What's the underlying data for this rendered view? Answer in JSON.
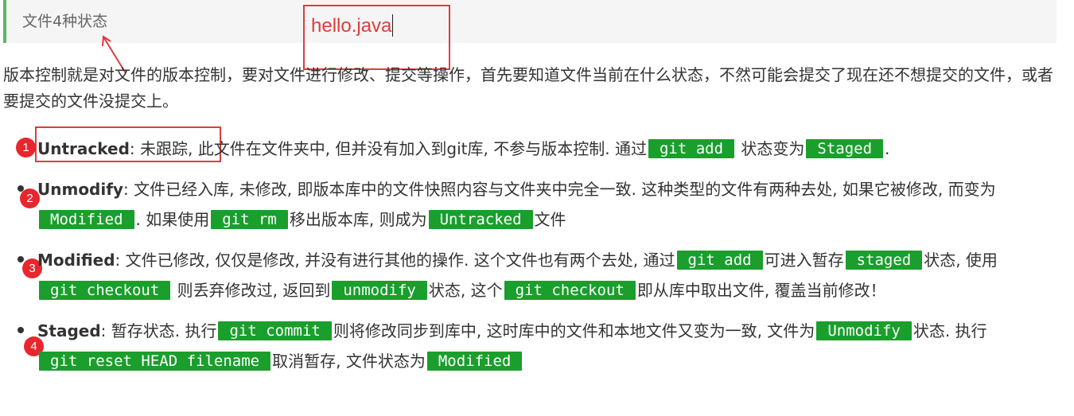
{
  "heading": {
    "title": "文件4种状态"
  },
  "annotation": {
    "text": "hello.java"
  },
  "intro": "版本控制就是对文件的版本控制，要对文件进行修改、提交等操作，首先要知道文件当前在什么状态，不然可能会提交了现在还不想提交的文件，或者要提交的文件没提交上。",
  "items": [
    {
      "marker": "1",
      "term": "Untracked",
      "seg0": ": 未跟踪, 此文件在文件夹中, 但并没有加入到git库, 不参与版本控制. 通过",
      "code0": "git add",
      "seg1": " 状态变为",
      "code1": "Staged",
      "seg2": "."
    },
    {
      "marker": "2",
      "term": "Unmodify",
      "seg0": ": 文件已经入库, 未修改, 即版本库中的文件快照内容与文件夹中完全一致. 这种类型的文件有两种去处, 如果它被修改, 而变为",
      "code0": "Modified",
      "seg1": ". 如果使用",
      "code1": "git rm",
      "seg2": "移出版本库, 则成为",
      "code2": "Untracked",
      "seg3": "文件"
    },
    {
      "marker": "3",
      "term": "Modified",
      "seg0": ": 文件已修改, 仅仅是修改, 并没有进行其他的操作. 这个文件也有两个去处, 通过",
      "code0": "git add",
      "seg1": "可进入暂存",
      "code1": "staged",
      "seg2": "状态, 使用",
      "code2": "git checkout",
      "seg3": " 则丢弃修改过, 返回到",
      "code3": "unmodify",
      "seg4": "状态, 这个",
      "code4": "git checkout",
      "seg5": "即从库中取出文件, 覆盖当前修改！"
    },
    {
      "marker": "4",
      "term": "Staged",
      "seg0": ": 暂存状态. 执行",
      "code0": "git commit",
      "seg1": "则将修改同步到库中, 这时库中的文件和本地文件又变为一致, 文件为",
      "code1": "Unmodify",
      "seg2": "状态. 执行",
      "code2": "git reset HEAD filename",
      "seg3": "取消暂存, 文件状态为",
      "code3": "Modified"
    }
  ],
  "colors": {
    "code_bg": "#1a9e2c",
    "annotation_red": "#e03c3c",
    "marker_red": "#e8262e",
    "heading_accent": "#5cb85c"
  }
}
